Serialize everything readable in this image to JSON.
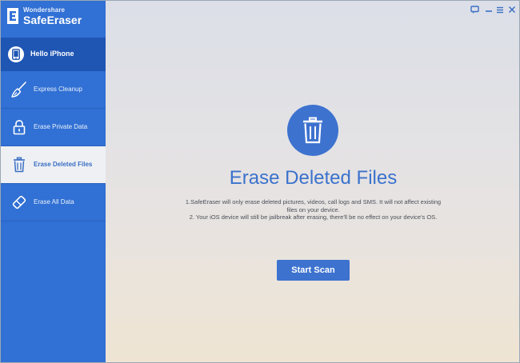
{
  "app": {
    "brand_small": "Wondershare",
    "brand_name": "SafeEraser"
  },
  "sidebar": {
    "device_label": "Hello iPhone",
    "items": [
      {
        "label": "Express Cleanup",
        "icon": "broom-icon",
        "active": false
      },
      {
        "label": "Erase Private Data",
        "icon": "lock-icon",
        "active": false
      },
      {
        "label": "Erase Deleted Files",
        "icon": "trash-icon",
        "active": true
      },
      {
        "label": "Erase All Data",
        "icon": "eraser-icon",
        "active": false
      }
    ]
  },
  "main": {
    "title": "Erase Deleted Files",
    "note_line1": "1.SafeEraser will only erase deleted pictures, videos, call logs and SMS. It will not affect existing",
    "note_line2": "files on your device.",
    "note_line3": "2.  Your iOS  device will still be jailbreak after erasing, there'll be no effect on your device's OS.",
    "button_label": "Start Scan"
  },
  "colors": {
    "sidebar_bg": "#3170d4",
    "device_bg": "#1f56b4",
    "accent": "#3d72cf"
  }
}
